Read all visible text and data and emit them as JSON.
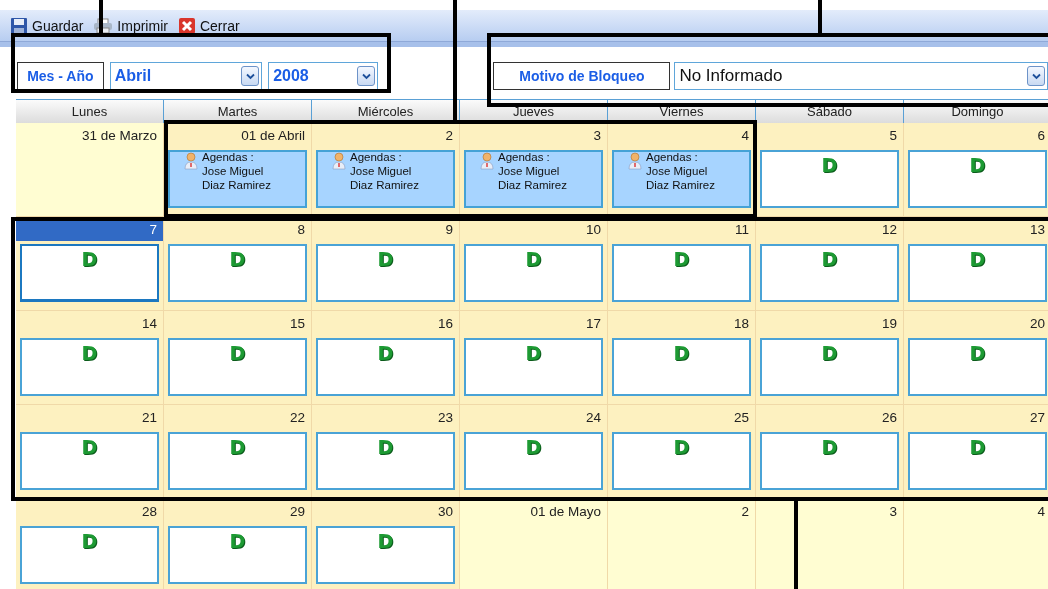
{
  "toolbar": [
    {
      "kind": "save",
      "label": "Guardar"
    },
    {
      "kind": "print",
      "label": "Imprimir"
    },
    {
      "kind": "close",
      "label": "Cerrar"
    }
  ],
  "filters": {
    "period_label": "Mes - Año",
    "month": "Abril",
    "year": "2008",
    "reason_label": "Motivo de Bloqueo",
    "reason": "No Informado"
  },
  "weekdays": [
    "Lunes",
    "Martes",
    "Miércoles",
    "Jueves",
    "Viernes",
    "Sábado",
    "Domingo"
  ],
  "weeks": [
    [
      {
        "label": "31 de Marzo",
        "in_month": false,
        "selected": false,
        "kind": "none"
      },
      {
        "label": "01 de Abril",
        "in_month": true,
        "selected": false,
        "kind": "agenda",
        "title": "Agendas :",
        "name": "Jose Miguel Diaz Ramirez"
      },
      {
        "label": "2",
        "in_month": true,
        "selected": false,
        "kind": "agenda",
        "title": "Agendas :",
        "name": "Jose Miguel Diaz Ramirez"
      },
      {
        "label": "3",
        "in_month": true,
        "selected": false,
        "kind": "agenda",
        "title": "Agendas :",
        "name": "Jose Miguel Diaz Ramirez"
      },
      {
        "label": "4",
        "in_month": true,
        "selected": false,
        "kind": "agenda",
        "title": "Agendas :",
        "name": "Jose Miguel Diaz Ramirez"
      },
      {
        "label": "5",
        "in_month": true,
        "selected": false,
        "kind": "free",
        "mark": "D"
      },
      {
        "label": "6",
        "in_month": true,
        "selected": false,
        "kind": "free",
        "mark": "D"
      }
    ],
    [
      {
        "label": "7",
        "in_month": true,
        "selected": true,
        "kind": "free",
        "mark": "D"
      },
      {
        "label": "8",
        "in_month": true,
        "selected": false,
        "kind": "free",
        "mark": "D"
      },
      {
        "label": "9",
        "in_month": true,
        "selected": false,
        "kind": "free",
        "mark": "D"
      },
      {
        "label": "10",
        "in_month": true,
        "selected": false,
        "kind": "free",
        "mark": "D"
      },
      {
        "label": "11",
        "in_month": true,
        "selected": false,
        "kind": "free",
        "mark": "D"
      },
      {
        "label": "12",
        "in_month": true,
        "selected": false,
        "kind": "free",
        "mark": "D"
      },
      {
        "label": "13",
        "in_month": true,
        "selected": false,
        "kind": "free",
        "mark": "D"
      }
    ],
    [
      {
        "label": "14",
        "in_month": true,
        "selected": false,
        "kind": "free",
        "mark": "D"
      },
      {
        "label": "15",
        "in_month": true,
        "selected": false,
        "kind": "free",
        "mark": "D"
      },
      {
        "label": "16",
        "in_month": true,
        "selected": false,
        "kind": "free",
        "mark": "D"
      },
      {
        "label": "17",
        "in_month": true,
        "selected": false,
        "kind": "free",
        "mark": "D"
      },
      {
        "label": "18",
        "in_month": true,
        "selected": false,
        "kind": "free",
        "mark": "D"
      },
      {
        "label": "19",
        "in_month": true,
        "selected": false,
        "kind": "free",
        "mark": "D"
      },
      {
        "label": "20",
        "in_month": true,
        "selected": false,
        "kind": "free",
        "mark": "D"
      }
    ],
    [
      {
        "label": "21",
        "in_month": true,
        "selected": false,
        "kind": "free",
        "mark": "D"
      },
      {
        "label": "22",
        "in_month": true,
        "selected": false,
        "kind": "free",
        "mark": "D"
      },
      {
        "label": "23",
        "in_month": true,
        "selected": false,
        "kind": "free",
        "mark": "D"
      },
      {
        "label": "24",
        "in_month": true,
        "selected": false,
        "kind": "free",
        "mark": "D"
      },
      {
        "label": "25",
        "in_month": true,
        "selected": false,
        "kind": "free",
        "mark": "D"
      },
      {
        "label": "26",
        "in_month": true,
        "selected": false,
        "kind": "free",
        "mark": "D"
      },
      {
        "label": "27",
        "in_month": true,
        "selected": false,
        "kind": "free",
        "mark": "D"
      }
    ],
    [
      {
        "label": "28",
        "in_month": true,
        "selected": false,
        "kind": "free",
        "mark": "D"
      },
      {
        "label": "29",
        "in_month": true,
        "selected": false,
        "kind": "free",
        "mark": "D"
      },
      {
        "label": "30",
        "in_month": true,
        "selected": false,
        "kind": "free",
        "mark": "D"
      },
      {
        "label": "01 de Mayo",
        "in_month": false,
        "selected": false,
        "kind": "none"
      },
      {
        "label": "2",
        "in_month": false,
        "selected": false,
        "kind": "none"
      },
      {
        "label": "3",
        "in_month": false,
        "selected": false,
        "kind": "none"
      },
      {
        "label": "4",
        "in_month": false,
        "selected": false,
        "kind": "none"
      }
    ]
  ]
}
